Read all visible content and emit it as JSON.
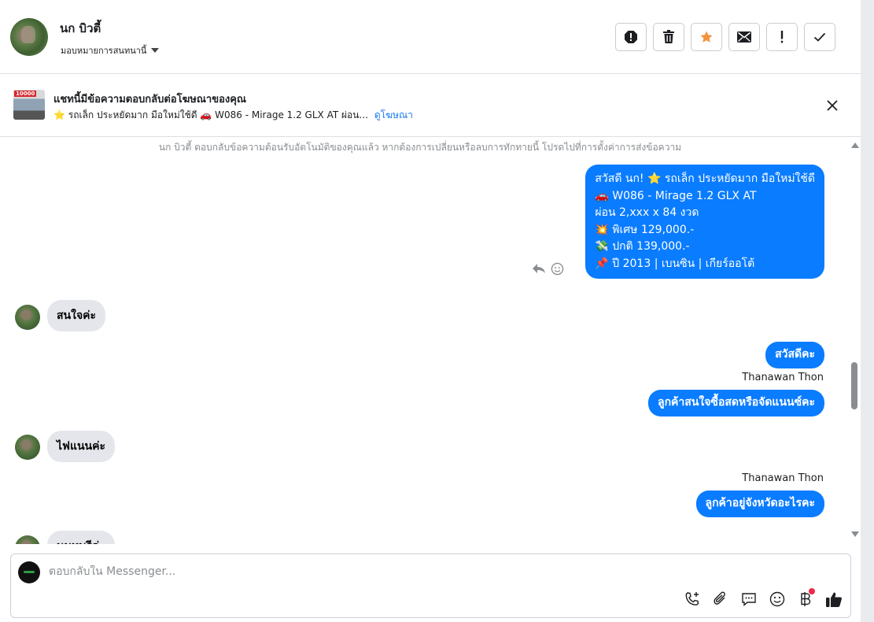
{
  "header": {
    "contact_name": "นก บิวตี้",
    "assign_label": "มอบหมายการสนทนานี้",
    "actions": [
      "report-icon",
      "trash-icon",
      "star-icon",
      "mail-icon",
      "exclamation-icon",
      "check-icon"
    ]
  },
  "ad": {
    "thumb_tag": "10000",
    "title": "แชทนี้มีข้อความตอบกลับต่อโฆษณาของคุณ",
    "subtitle": "⭐ รถเล็ก ประหยัดมาก มือใหม่ใช้ดี 🚗 W086 - Mirage 1.2 GLX AT ผ่อน...",
    "link": "ดูโฆษณา"
  },
  "chat": {
    "notice": "นก บิวตี้ ตอบกลับข้อความต้อนรับอัตโนมัติของคุณแล้ว หากต้องการเปลี่ยนหรือลบการทักทายนี้ โปรดไปที่การตั้งค่าการส่งข้อความ",
    "greeting_lines": [
      "สวัสดี นก! ⭐ รถเล็ก ประหยัดมาก มือใหม่ใช้ดี",
      "🚗 W086 - Mirage 1.2 GLX AT",
      "ผ่อน 2,xxx x 84 งวด",
      "💥 พิเศษ 129,000.-",
      "💸 ปกติ 139,000.-",
      "📌 ปี 2013 | เบนซิน | เกียร์ออโต้"
    ],
    "in_msg_1": "สนใจค่ะ",
    "out_msg_1": "สวัสดีคะ",
    "sender_1": "Thanawan Thon",
    "out_msg_2": "ลูกค้าสนใจซื้อสดหรือจัดแนนซ์คะ",
    "in_msg_2": "ไฟแนนค่ะ",
    "sender_2": "Thanawan Thon",
    "out_msg_3": "ลูกค้าอยู่จังหวัดอะไรคะ",
    "in_msg_3": "นนทบุรีค่ะ"
  },
  "composer": {
    "placeholder": "ตอบกลับใน Messenger...",
    "tools": [
      "phone-add-icon",
      "attachment-icon",
      "quick-reply-icon",
      "emoji-icon",
      "baht-payment-icon",
      "thumbs-up-icon"
    ]
  },
  "colors": {
    "outgoing_bubble": "#0a7cff",
    "incoming_bubble": "#e4e6eb",
    "star_active": "#f5923e",
    "link": "#1877f2"
  }
}
